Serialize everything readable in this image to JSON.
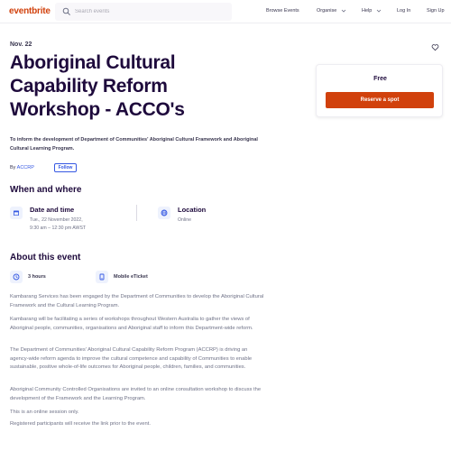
{
  "header": {
    "logo": "eventbrite",
    "search_placeholder": "Search events",
    "nav": [
      {
        "label": "Browse Events"
      },
      {
        "label": "Organise"
      },
      {
        "label": "Help"
      },
      {
        "label": "Log In"
      },
      {
        "label": "Sign Up"
      }
    ]
  },
  "event": {
    "date_short": "Nov. 22",
    "title": "Aboriginal Cultural Capability Reform Workshop - ACCO's",
    "summary": "To inform the development of Department of Communities' Aboriginal Cultural Framework and Aboriginal Cultural Learning Program.",
    "by_prefix": "By",
    "organizer": "ACCRP",
    "follow_label": "Follow"
  },
  "when_where": {
    "heading": "When and where",
    "date_title": "Date and time",
    "date_line1": "Tue., 22 November 2022,",
    "date_line2": "9:30 am – 12:30 pm AWST",
    "location_title": "Location",
    "location_value": "Online"
  },
  "about": {
    "heading": "About this event",
    "duration": "3 hours",
    "ticket_type": "Mobile eTicket",
    "paragraphs": [
      "Kambarang Services has been engaged by the Department of Communities to develop the Aboriginal Cultural Framework and the Cultural Learning Program.",
      "Kambarang will be facilitating a series of workshops throughout Western Australia to gather the views of Aboriginal people, communities, organisations and Aboriginal staff to inform this Department-wide reform.",
      "The Department of Communities' Aboriginal Cultural Capability Reform Program (ACCRP) is driving an agency-wide reform agenda to improve the cultural competence and capability of Communities to enable sustainable, positive whole-of-life outcomes for Aboriginal people, children, families, and communities.",
      "Aboriginal Community Controlled Organisations are invited to an online consultation workshop to discuss the development of the Framework and the Learning Program.",
      "This is an online session only.",
      "Registered participants will receive the link prior to the event."
    ]
  },
  "ticket_card": {
    "price": "Free",
    "reserve_label": "Reserve a spot"
  },
  "colors": {
    "brand": "#d1410c",
    "link": "#3659e3",
    "heading": "#1e0a3c"
  },
  "icons": [
    "search-icon",
    "chevron-down-icon",
    "heart-icon",
    "calendar-icon",
    "globe-icon",
    "clock-icon",
    "ticket-icon"
  ]
}
